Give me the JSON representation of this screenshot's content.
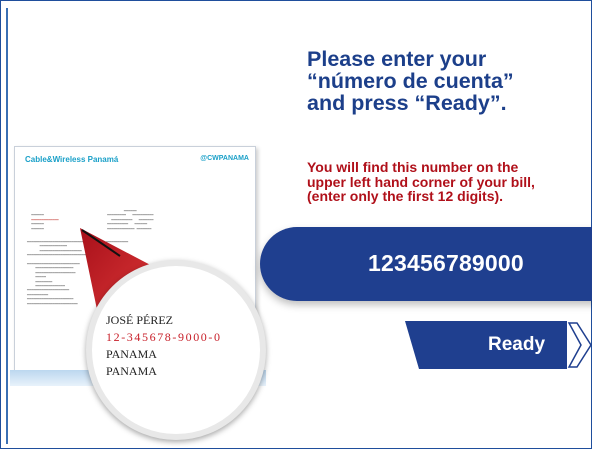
{
  "instruction_title": {
    "line1": "Please enter your",
    "line2": "“número de cuenta”",
    "line3": "and press “Ready”."
  },
  "hint": {
    "line1": "You will find this number on the",
    "line2": "upper left hand corner of your bill,",
    "line3": "(enter only the first 12 digits)."
  },
  "account_input": {
    "value": "123456789000"
  },
  "ready_button": {
    "label": "Ready"
  },
  "bill_image": {
    "brand": "Cable&Wireless Panamá",
    "social": "@CWPANAMA",
    "magnified": {
      "name": "JOSÉ PÉREZ",
      "account": "12-345678-9000-0",
      "line3": "PANAMA",
      "line4": "PANAMA"
    }
  },
  "colors": {
    "title": "#1c3f8a",
    "hint": "#b0101a",
    "input_bar": "#1f3f8f",
    "button": "#1f3f8f",
    "magnifier_cone": "#c8202a"
  }
}
